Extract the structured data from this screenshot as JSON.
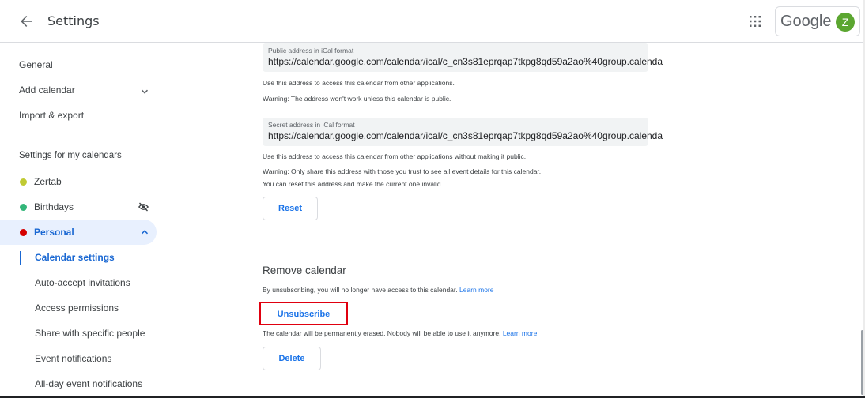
{
  "header": {
    "title": "Settings",
    "brand": "Google",
    "avatar_letter": "Z",
    "avatar_color": "#5ba630"
  },
  "sidebar": {
    "general": "General",
    "add_calendar": "Add calendar",
    "import_export": "Import & export",
    "section_title": "Settings for my calendars",
    "calendars": [
      {
        "label": "Zertab",
        "color": "#c0ca33"
      },
      {
        "label": "Birthdays",
        "color": "#33b679"
      },
      {
        "label": "Personal",
        "color": "#d50000"
      }
    ],
    "sub_items": [
      "Calendar settings",
      "Auto-accept invitations",
      "Access permissions",
      "Share with specific people",
      "Event notifications",
      "All-day event notifications"
    ]
  },
  "main": {
    "public": {
      "label": "Public address in iCal format",
      "value": "https://calendar.google.com/calendar/ical/c_cn3s81eprqap7tkpg8qd59a2ao%40group.calenda",
      "note1": "Use this address to access this calendar from other applications.",
      "note2": "Warning: The address won't work unless this calendar is public."
    },
    "secret": {
      "label": "Secret address in iCal format",
      "value": "https://calendar.google.com/calendar/ical/c_cn3s81eprqap7tkpg8qd59a2ao%40group.calenda",
      "note1": "Use this address to access this calendar from other applications without making it public.",
      "note2": "Warning: Only share this address with those you trust to see all event details for this calendar.",
      "note3": "You can reset this address and make the current one invalid."
    },
    "reset_label": "Reset",
    "remove": {
      "title": "Remove calendar",
      "unsub_note": "By unsubscribing, you will no longer have access to this calendar.",
      "unsub_label": "Unsubscribe",
      "delete_note": "The calendar will be permanently erased. Nobody will be able to use it anymore.",
      "delete_label": "Delete",
      "learn_more": "Learn more"
    }
  }
}
